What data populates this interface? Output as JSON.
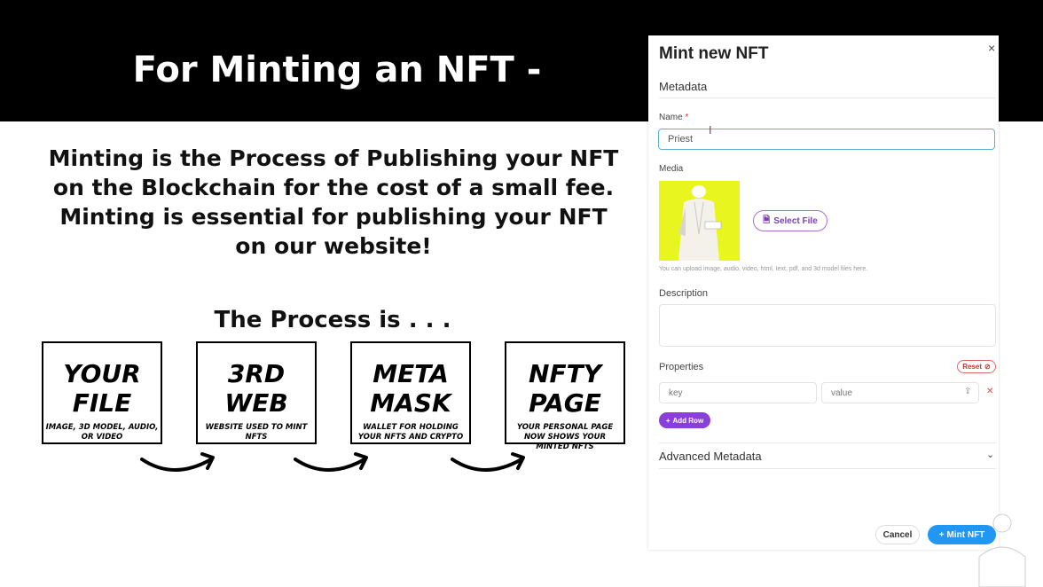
{
  "slide": {
    "title": "For Minting an NFT -",
    "intro": "Minting is the Process of Publishing your NFT on the Blockchain for the cost of a small fee. Minting is essential for publishing your NFT on our website!",
    "process_heading": "The Process is . . .",
    "steps": [
      {
        "title_line1": "YOUR",
        "title_line2": "FILE",
        "desc": "IMAGE, 3D MODEL, AUDIO, OR VIDEO"
      },
      {
        "title_line1": "3RD",
        "title_line2": "WEB",
        "desc": "WEBSITE USED TO MINT NFTS"
      },
      {
        "title_line1": "META",
        "title_line2": "MASK",
        "desc": "WALLET FOR HOLDING YOUR NFTS AND CRYPTO"
      },
      {
        "title_line1": "NFTY",
        "title_line2": "PAGE",
        "desc": "YOUR PERSONAL PAGE NOW SHOWS YOUR MINTED NFTS"
      }
    ]
  },
  "modal": {
    "title": "Mint new NFT",
    "close": "×",
    "metadata_label": "Metadata",
    "name_label": "Name",
    "name_required": "*",
    "name_value": "Priest",
    "media_label": "Media",
    "select_file_label": "Select File",
    "upload_hint": "You can upload image, audio, video, html, text, pdf, and 3d model files here.",
    "description_label": "Description",
    "properties_label": "Properties",
    "reset_label": "Reset",
    "key_placeholder": "key",
    "value_placeholder": "value",
    "add_row_label": "Add Row",
    "advanced_label": "Advanced Metadata",
    "cancel_label": "Cancel",
    "mint_label": "Mint NFT"
  },
  "colors": {
    "title_band": "#000000",
    "media_bg": "#e9f51f",
    "accent_purple": "#8b3fd9",
    "accent_blue": "#2196f3"
  }
}
